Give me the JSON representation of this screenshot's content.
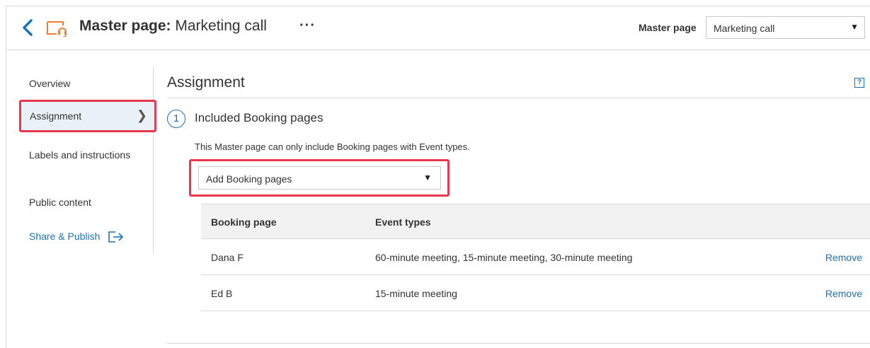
{
  "header": {
    "title_prefix": "Master page:",
    "title_name": " Marketing call",
    "more_label": "···",
    "master_page_label": "Master page",
    "master_page_value": "Marketing call",
    "caret": "▼"
  },
  "sidebar": {
    "items": [
      {
        "label": "Overview"
      },
      {
        "label": "Assignment",
        "chevron": "❯"
      },
      {
        "label": "Labels and instructions"
      },
      {
        "label": "Public content"
      },
      {
        "label": "Share & Publish"
      }
    ]
  },
  "main": {
    "section_title": "Assignment",
    "help_label": "?",
    "step_number": "1",
    "step_title": "Included Booking pages",
    "step_note": "This Master page can only include Booking pages with Event types.",
    "add_select_value": "Add Booking pages",
    "caret": "▼",
    "table": {
      "headers": [
        "Booking page",
        "Event types"
      ],
      "rows": [
        {
          "page": "Dana F",
          "events": "60-minute meeting, 15-minute meeting, 30-minute meeting",
          "action": "Remove"
        },
        {
          "page": "Ed B",
          "events": "15-minute meeting",
          "action": "Remove"
        }
      ]
    }
  },
  "colors": {
    "accent": "#1a73b8",
    "highlight": "#e8384f",
    "icon_orange": "#f07c2d",
    "selected_bg": "#eaf1f7"
  },
  "icons": [
    "back-chevron-icon",
    "master-page-icon",
    "share-icon",
    "help-icon"
  ]
}
